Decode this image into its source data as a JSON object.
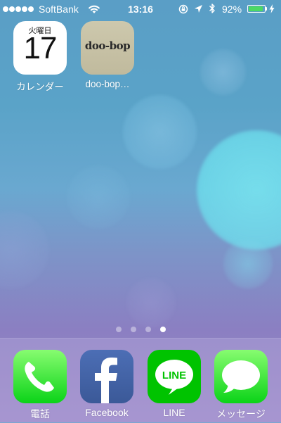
{
  "status_bar": {
    "carrier": "SoftBank",
    "time": "13:16",
    "battery_percent": "92%",
    "battery_level": 0.92,
    "signal_bars": 5,
    "icons": [
      "wifi-icon",
      "rotation-lock-icon",
      "location-icon",
      "bluetooth-icon",
      "battery-icon",
      "charging-icon"
    ]
  },
  "home": {
    "apps": [
      {
        "id": "calendar",
        "label": "カレンダー",
        "weekday": "火曜日",
        "day": "17",
        "icon": "calendar-icon"
      },
      {
        "id": "doo-bop",
        "label": "doo-bop…",
        "logo_text": "doo-bop",
        "icon": "doo-bop-icon"
      }
    ]
  },
  "page_indicator": {
    "count": 4,
    "current": 4
  },
  "dock": {
    "apps": [
      {
        "id": "phone",
        "label": "電話",
        "icon": "phone-icon",
        "color": "#0bd318"
      },
      {
        "id": "facebook",
        "label": "Facebook",
        "icon": "facebook-icon",
        "color": "#3b5998"
      },
      {
        "id": "line",
        "label": "LINE",
        "icon": "line-icon",
        "color": "#00c300",
        "logo_text": "LINE"
      },
      {
        "id": "messages",
        "label": "メッセージ",
        "icon": "messages-icon",
        "color": "#0bd318"
      }
    ]
  },
  "colors": {
    "battery_fill": "#4cd964",
    "status_text": "#ffffff"
  }
}
